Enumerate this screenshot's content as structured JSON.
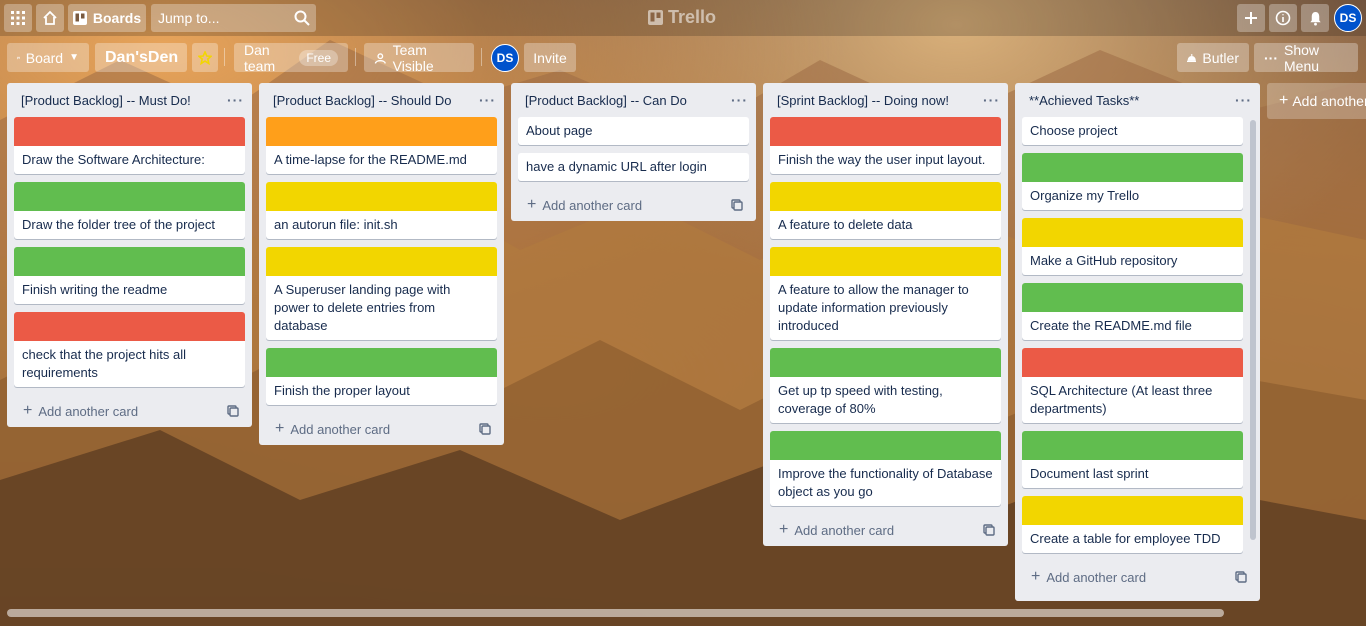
{
  "header": {
    "apps_icon": "grid-icon",
    "home_icon": "home-icon",
    "boards_label": "Boards",
    "search_placeholder": "Jump to...",
    "logo_text": "Trello",
    "user_initials": "DS"
  },
  "board_header": {
    "view_label": "Board",
    "board_name": "Dan'sDen",
    "team_name": "Dan team",
    "team_plan": "Free",
    "visibility": "Team Visible",
    "member_initials": "DS",
    "invite_label": "Invite",
    "butler_label": "Butler",
    "menu_label": "Show Menu"
  },
  "colors": {
    "red": "#eb5a46",
    "green": "#61bd4f",
    "yellow": "#f2d600",
    "orange": "#ff9f1a",
    "accent": "#0052cc"
  },
  "add_card_label": "Add another card",
  "add_list_label": "Add another list",
  "lists": [
    {
      "title": "[Product Backlog] -- Must Do!",
      "cards": [
        {
          "label": "red",
          "text": "Draw the Software Architecture:"
        },
        {
          "label": "green",
          "text": "Draw the folder tree of the project"
        },
        {
          "label": "green",
          "text": "Finish writing the readme"
        },
        {
          "label": "red",
          "text": "check that the project hits all requirements"
        }
      ]
    },
    {
      "title": "[Product Backlog] -- Should Do",
      "cards": [
        {
          "label": "orange",
          "text": "A time-lapse for the README.md"
        },
        {
          "label": "yellow",
          "text": "an autorun file: init.sh"
        },
        {
          "label": "yellow",
          "text": "A Superuser landing page with power to delete entries from database"
        },
        {
          "label": "green",
          "text": "Finish the proper layout"
        }
      ]
    },
    {
      "title": "[Product Backlog] -- Can Do",
      "cards": [
        {
          "label": "",
          "text": "About page"
        },
        {
          "label": "",
          "text": "have a dynamic URL after login"
        }
      ]
    },
    {
      "title": "[Sprint Backlog] -- Doing now!",
      "cards": [
        {
          "label": "red",
          "text": "Finish the way the user input layout."
        },
        {
          "label": "yellow",
          "text": "A feature to delete data"
        },
        {
          "label": "yellow",
          "text": "A feature to allow the manager to update information previously introduced"
        },
        {
          "label": "green",
          "text": "Get up tp speed with testing, coverage of 80%"
        },
        {
          "label": "green",
          "text": "Improve the functionality of Database object as you go"
        }
      ]
    },
    {
      "title": "**Achieved Tasks**",
      "cards": [
        {
          "label": "",
          "text": "Choose project"
        },
        {
          "label": "green",
          "text": "Organize my Trello"
        },
        {
          "label": "yellow",
          "text": "Make a GitHub repository"
        },
        {
          "label": "green",
          "text": "Create the README.md file"
        },
        {
          "label": "red",
          "text": "SQL Architecture (At least three departments)"
        },
        {
          "label": "green",
          "text": "Document last sprint"
        },
        {
          "label": "yellow",
          "text": "Create a table for employee TDD"
        }
      ]
    }
  ]
}
